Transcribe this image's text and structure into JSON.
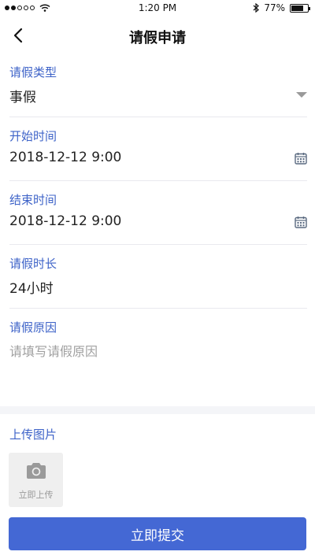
{
  "status_bar": {
    "signal_dots": [
      true,
      true,
      false,
      false,
      false
    ],
    "time": "1:20 PM",
    "battery_percent": "77%",
    "battery_level": 0.77
  },
  "nav": {
    "title": "请假申请"
  },
  "form": {
    "leave_type": {
      "label": "请假类型",
      "value": "事假"
    },
    "start_time": {
      "label": "开始时间",
      "value": "2018-12-12 9:00"
    },
    "end_time": {
      "label": "结束时间",
      "value": "2018-12-12 9:00"
    },
    "duration": {
      "label": "请假时长",
      "value": "24小时"
    },
    "reason": {
      "label": "请假原因",
      "placeholder": "请填写请假原因"
    }
  },
  "upload": {
    "label": "上传图片",
    "button_text": "立即上传"
  },
  "submit": {
    "label": "立即提交"
  },
  "colors": {
    "accent": "#3e63c8",
    "button": "#4468d4",
    "placeholder": "#a0a0a0"
  }
}
